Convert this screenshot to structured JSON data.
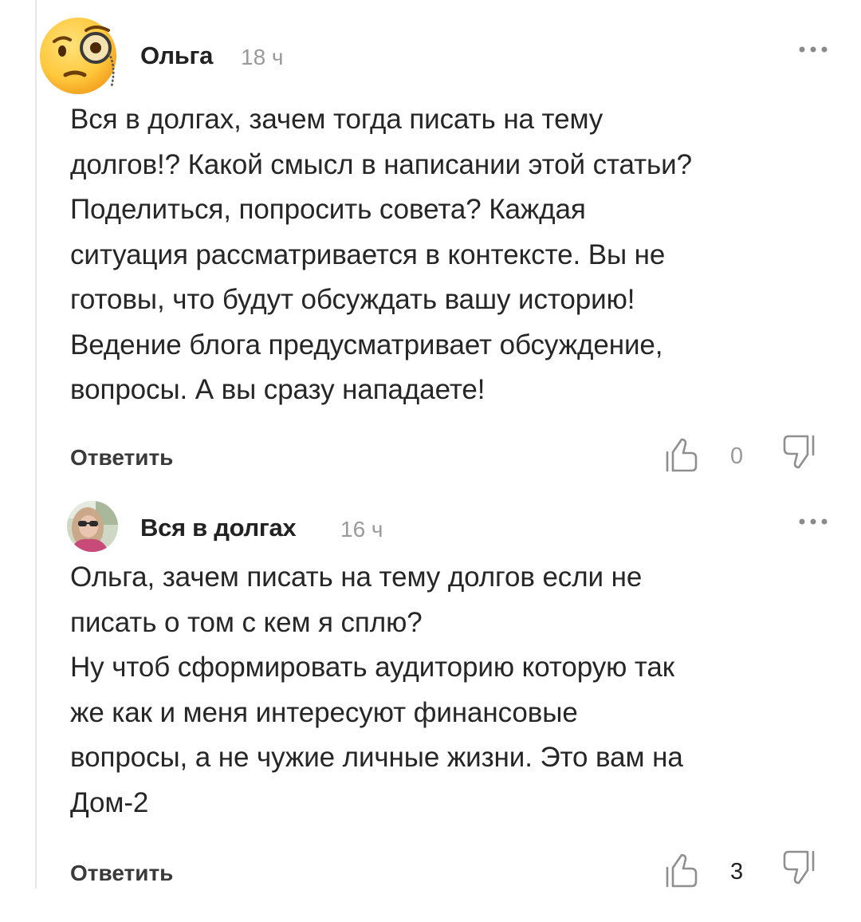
{
  "comments": [
    {
      "author": "Ольга",
      "time": "18 ч",
      "text": "Вся в долгах, зачем тогда писать на тему\nдолгов!? Какой смысл в написании этой статьи?\nПоделиться, попросить совета? Каждая\nситуация рассматривается в контексте. Вы не\nготовы, что будут обсуждать вашу историю!\nВедение блога предусматривает обсуждение,\nвопросы. А вы сразу нападаете!",
      "reply_label": "Ответить",
      "likes": "0",
      "avatar_icon": "monocle-face-emoji"
    },
    {
      "author": "Вся в долгах",
      "time": "16 ч",
      "text": "Ольга, зачем писать на тему долгов если не\nписать о том с кем я сплю?\nНу чтоб сформировать аудиторию которую так\nже как и меня интересуют финансовые\nвопросы, а не чужие личные жизни. Это вам на\nДом-2",
      "reply_label": "Ответить",
      "likes": "3",
      "avatar_icon": "user-photo"
    }
  ],
  "icons": {
    "more": "more-dots-icon",
    "like": "thumb-up-icon",
    "dislike": "thumb-down-icon"
  },
  "colors": {
    "text": "#262626",
    "muted": "#9a9a9a",
    "emoji_yellow": "#FFC83D"
  }
}
